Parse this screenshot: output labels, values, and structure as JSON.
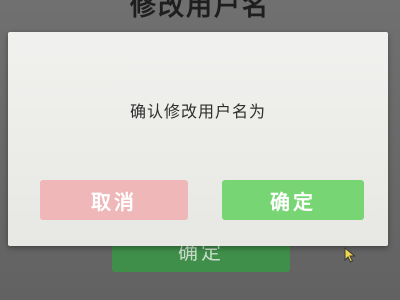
{
  "background": {
    "title": "修改用户名",
    "confirm_label": "确定"
  },
  "dialog": {
    "message": "确认修改用户名为",
    "cancel_label": "取消",
    "confirm_label": "确定"
  },
  "colors": {
    "cancel_button": "#efb7b7",
    "confirm_button": "#78d574",
    "background_confirm_button": "#3f8e49",
    "dialog_background": "#ecece9"
  },
  "icons": {
    "cursor": "mouse-cursor-icon"
  }
}
